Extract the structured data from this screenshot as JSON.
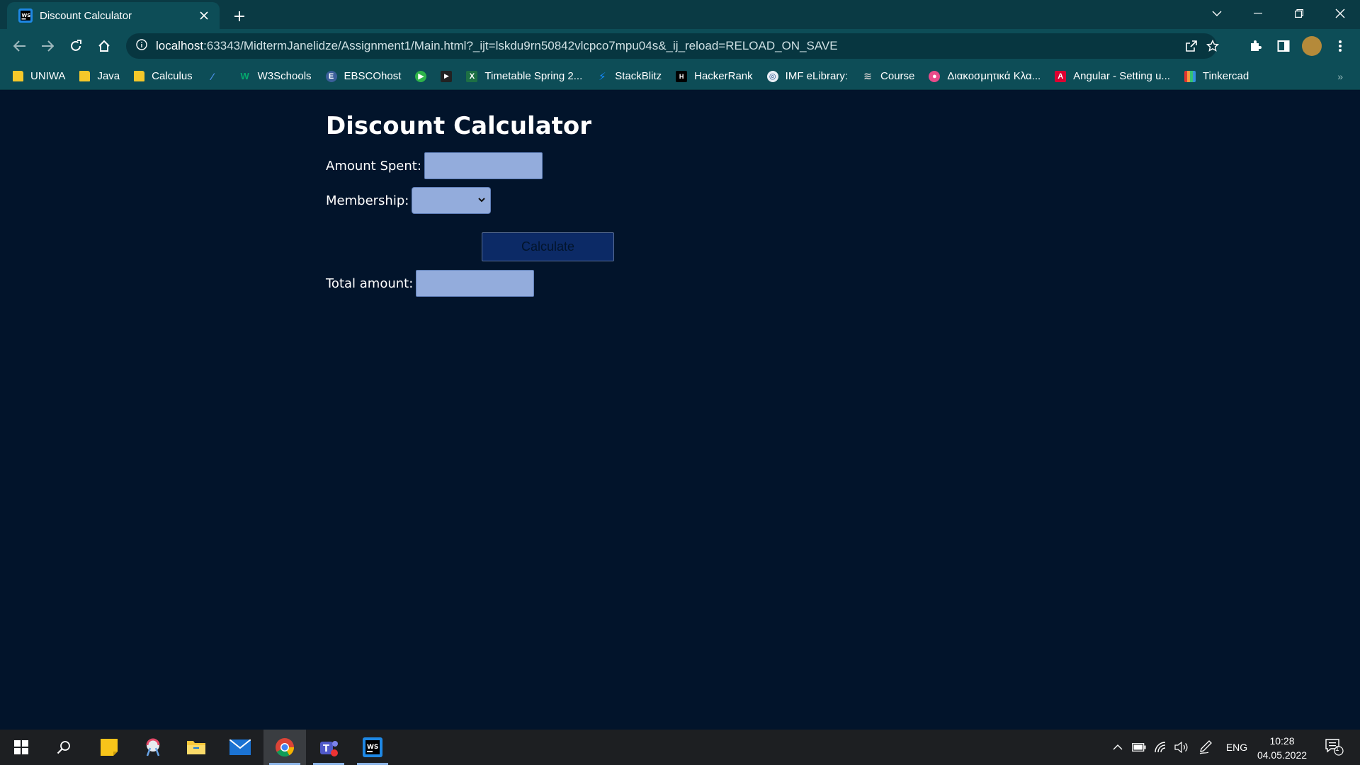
{
  "browser": {
    "tab_title": "Discount Calculator",
    "url_host": "localhost",
    "url_rest": ":63343/MidtermJanelidze/Assignment1/Main.html?_ijt=lskdu9rn50842vlcpco7mpu04s&_ij_reload=RELOAD_ON_SAVE"
  },
  "bookmarks": [
    {
      "label": "UNIWA",
      "icon": "folder-icon"
    },
    {
      "label": "Java",
      "icon": "folder-icon"
    },
    {
      "label": "Calculus",
      "icon": "folder-icon"
    },
    {
      "label": "",
      "icon": "pen-icon"
    },
    {
      "label": "W3Schools",
      "icon": "w3schools-icon"
    },
    {
      "label": "EBSCOhost",
      "icon": "ebsco-icon"
    },
    {
      "label": "",
      "icon": "play-circle-icon"
    },
    {
      "label": "",
      "icon": "play-icon"
    },
    {
      "label": "Timetable Spring 2...",
      "icon": "excel-icon"
    },
    {
      "label": "StackBlitz",
      "icon": "bolt-icon"
    },
    {
      "label": "HackerRank",
      "icon": "hackerrank-icon"
    },
    {
      "label": "IMF eLibrary:",
      "icon": "imf-icon"
    },
    {
      "label": "Course",
      "icon": "course-icon"
    },
    {
      "label": "Διακοσμητικά Κλα...",
      "icon": "color-icon"
    },
    {
      "label": "Angular - Setting u...",
      "icon": "angular-icon"
    },
    {
      "label": "Tinkercad",
      "icon": "tinkercad-icon"
    }
  ],
  "app": {
    "title": "Discount Calculator",
    "amount_label": "Amount Spent:",
    "amount_value": "",
    "membership_label": "Membership:",
    "membership_value": "",
    "calculate_label": "Calculate",
    "total_label": "Total amount:",
    "total_value": ""
  },
  "taskbar": {
    "language": "ENG",
    "time": "10:28",
    "date": "04.05.2022",
    "notification_count": "1"
  },
  "colors": {
    "page_bg": "#02142b",
    "field_bg": "#93acdc",
    "button_bg": "#0c2a66",
    "chrome_bg": "#0d4d57"
  }
}
